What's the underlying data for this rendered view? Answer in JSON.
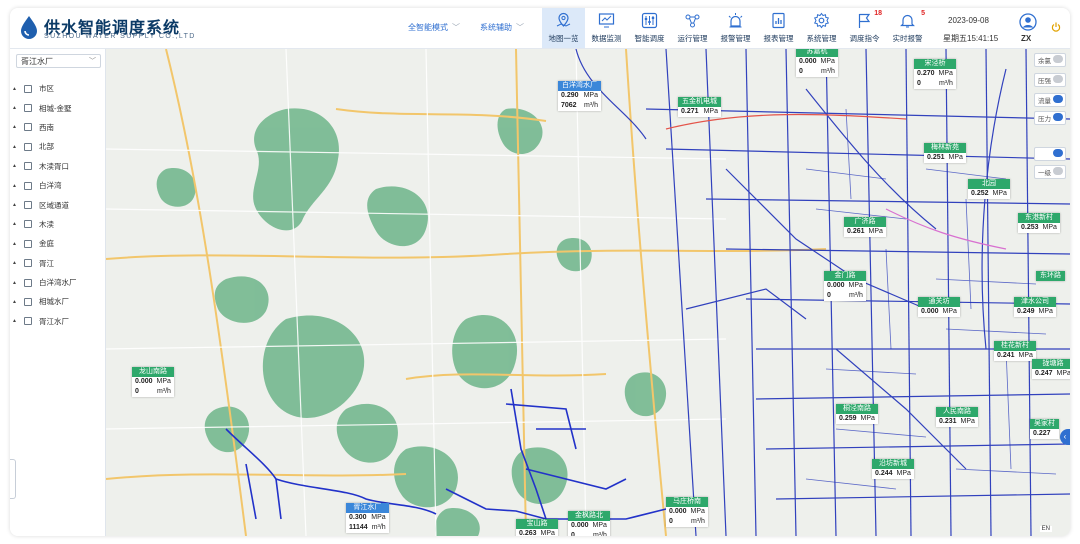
{
  "header": {
    "title": "供水智能调度系统",
    "subtitle": "SUZHOU WATER SUPPLY CO.,LTD",
    "mode_select": "全智能模式",
    "assist_select": "系统辅助",
    "date": "2023-09-08",
    "datetime": "星期五15:41:15",
    "user": "ZX"
  },
  "nav": [
    {
      "label": "地图一览",
      "icon": "map-pin-icon",
      "active": true
    },
    {
      "label": "数据监测",
      "icon": "monitor-chart-icon"
    },
    {
      "label": "智能调度",
      "icon": "sliders-icon"
    },
    {
      "label": "运行管理",
      "icon": "network-icon"
    },
    {
      "label": "报警管理",
      "icon": "alarm-light-icon"
    },
    {
      "label": "报表管理",
      "icon": "report-icon"
    },
    {
      "label": "系统管理",
      "icon": "gear-icon"
    },
    {
      "label": "调度指令",
      "icon": "flag-icon",
      "badge": "18"
    },
    {
      "label": "实时报警",
      "icon": "bell-icon",
      "badge": "5"
    }
  ],
  "sidebar": {
    "select_value": "胥江水厂",
    "items": [
      "市区",
      "相城-金墅",
      "西南",
      "北部",
      "木渎胥口",
      "白洋湾",
      "区域通道",
      "木渎",
      "金庭",
      "胥江",
      "白洋湾水厂",
      "相城水厂",
      "胥江水厂"
    ]
  },
  "map_controls": [
    {
      "label": "余氯",
      "on": false
    },
    {
      "label": "压强",
      "on": false
    },
    {
      "label": "流量",
      "on": true
    },
    {
      "label": "压力",
      "on": true
    },
    {
      "label": "",
      "on": true
    },
    {
      "label": "一级",
      "on": false
    }
  ],
  "stations": [
    {
      "name": "白洋湾水厂",
      "color": "#3b87d9",
      "l1": "0.290",
      "u1": "MPa",
      "l2": "7062",
      "u2": "m³/h"
    },
    {
      "name": "五金机电城",
      "color": "#2ea86b",
      "l1": "0.271",
      "u1": "MPa"
    },
    {
      "name": "苏嘉杭",
      "color": "#2ea86b",
      "l1": "0.000",
      "u1": "MPa",
      "l2": "0",
      "u2": "m³/h"
    },
    {
      "name": "宋泾桥",
      "color": "#2ea86b",
      "l1": "0.270",
      "u1": "MPa",
      "l2": "0",
      "u2": "m³/h"
    },
    {
      "name": "梅林新苑",
      "color": "#2ea86b",
      "l1": "0.251",
      "u1": "MPa"
    },
    {
      "name": "北园",
      "color": "#2ea86b",
      "l1": "0.252",
      "u1": "MPa"
    },
    {
      "name": "东港新村",
      "color": "#2ea86b",
      "l1": "0.253",
      "u1": "MPa"
    },
    {
      "name": "广济路",
      "color": "#2ea86b",
      "l1": "0.261",
      "u1": "MPa"
    },
    {
      "name": "金门路",
      "color": "#2ea86b",
      "l1": "0.000",
      "u1": "MPa",
      "l2": "0",
      "u2": "m³/h"
    },
    {
      "name": "东环路",
      "color": "#2ea86b",
      "l1": "",
      "u1": ""
    },
    {
      "name": "通关坊",
      "color": "#2ea86b",
      "l1": "0.000",
      "u1": "MPa"
    },
    {
      "name": "津水公司",
      "color": "#2ea86b",
      "l1": "0.249",
      "u1": "MPa"
    },
    {
      "name": "桂花新村",
      "color": "#2ea86b",
      "l1": "0.241",
      "u1": "MPa"
    },
    {
      "name": "拢塘路",
      "color": "#2ea86b",
      "l1": "0.247",
      "u1": "MPa"
    },
    {
      "name": "龙山南路",
      "color": "#2ea86b",
      "l1": "0.000",
      "u1": "MPa",
      "l2": "0",
      "u2": "m³/h"
    },
    {
      "name": "桐泾南路",
      "color": "#2ea86b",
      "l1": "0.259",
      "u1": "MPa"
    },
    {
      "name": "人民南路",
      "color": "#2ea86b",
      "l1": "0.231",
      "u1": "MPa"
    },
    {
      "name": "吴家村",
      "color": "#2ea86b",
      "l1": "0.227",
      "u1": ""
    },
    {
      "name": "沿坊新城",
      "color": "#2ea86b",
      "l1": "0.244",
      "u1": "MPa"
    },
    {
      "name": "胥江水厂",
      "color": "#3b87d9",
      "l1": "0.300",
      "u1": "MPa",
      "l2": "11144",
      "u2": "m³/h"
    },
    {
      "name": "宝山路",
      "color": "#2ea86b",
      "l1": "0.263",
      "u1": "MPa"
    },
    {
      "name": "金枫路北",
      "color": "#2ea86b",
      "l1": "0.000",
      "u1": "MPa",
      "l2": "0",
      "u2": "m³/h"
    },
    {
      "name": "马庄桥南",
      "color": "#2ea86b",
      "l1": "0.000",
      "u1": "MPa",
      "l2": "0",
      "u2": "m³/h"
    }
  ],
  "colors": {
    "pipe": "#1d2fb8",
    "green_area": "#6db58a",
    "accent": "#2f6fd0"
  }
}
